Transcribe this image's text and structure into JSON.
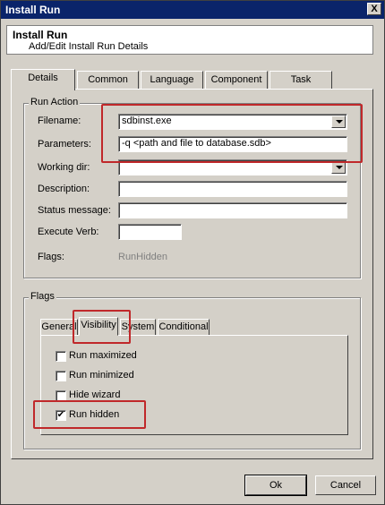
{
  "window": {
    "title": "Install Run",
    "close_glyph": "X"
  },
  "header": {
    "title": "Install Run",
    "subtitle": "Add/Edit Install Run Details"
  },
  "tabs": [
    {
      "label": "Details"
    },
    {
      "label": "Common"
    },
    {
      "label": "Language"
    },
    {
      "label": "Component"
    },
    {
      "label": "Task"
    }
  ],
  "run_action": {
    "group_label": "Run Action",
    "filename_label": "Filename:",
    "filename_value": "sdbinst.exe",
    "parameters_label": "Parameters:",
    "parameters_value": "-q <path and file to database.sdb>",
    "working_dir_label": "Working dir:",
    "working_dir_value": "",
    "description_label": "Description:",
    "description_value": "",
    "status_label": "Status message:",
    "status_value": "",
    "verb_label": "Execute Verb:",
    "verb_value": "",
    "flags_label": "Flags:",
    "flags_value": "RunHidden"
  },
  "flags": {
    "group_label": "Flags",
    "tabs": [
      {
        "label": "General"
      },
      {
        "label": "Visibility"
      },
      {
        "label": "System"
      },
      {
        "label": "Conditional"
      }
    ],
    "options": [
      {
        "label": "Run maximized",
        "checked": false,
        "mark": ""
      },
      {
        "label": "Run minimized",
        "checked": false,
        "mark": ""
      },
      {
        "label": "Hide wizard",
        "checked": false,
        "mark": ""
      },
      {
        "label": "Run hidden",
        "checked": true,
        "mark": "✔"
      }
    ]
  },
  "buttons": {
    "ok": "Ok",
    "cancel": "Cancel"
  },
  "highlight_color": "#c0282a"
}
